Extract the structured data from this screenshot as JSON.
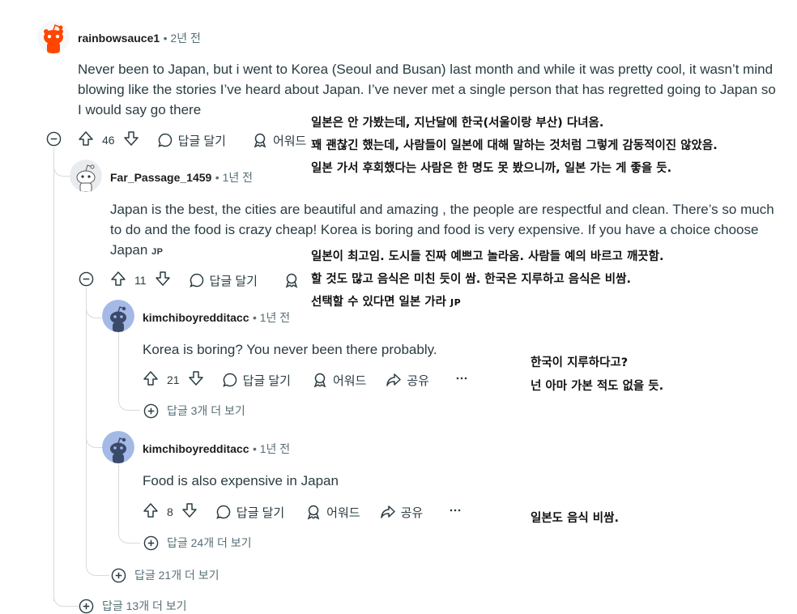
{
  "comments": [
    {
      "user": "rainbowsauce1",
      "time": "2년 전",
      "body": "Never been to Japan, but i went to Korea (Seoul and Busan) last month and while it was pretty cool, it wasn’t mind blowing like the stories I’ve heard about Japan. I’ve never met a single person that has regretted going to Japan so I would say go there",
      "votes": "46",
      "reply": "답글 달기",
      "award": "어워드"
    },
    {
      "user": "Far_Passage_1459",
      "time": "1년 전",
      "body": "Japan is the best, the cities are beautiful and amazing , the people are respectful and clean. There’s so much to do and the food is crazy cheap! Korea is boring and food is very expensive. If you have a choice choose Japan",
      "flag": "JP",
      "votes": "11",
      "reply": "답글 달기",
      "award": "어워드"
    },
    {
      "user": "kimchiboyredditacc",
      "time": "1년 전",
      "body": "Korea is boring? You never been there probably.",
      "votes": "21",
      "reply": "답글 달기",
      "award": "어워드",
      "share": "공유",
      "more_replies": "답글 3개 더 보기"
    },
    {
      "user": "kimchiboyredditacc",
      "time": "1년 전",
      "body": "Food is also expensive in Japan",
      "votes": "8",
      "reply": "답글 달기",
      "award": "어워드",
      "share": "공유",
      "more_replies": "답글 24개 더 보기"
    }
  ],
  "more_replies_level1": "답글 21개 더 보기",
  "more_replies_level0": "답글 13개 더 보기",
  "annotations": {
    "a1": [
      "일본은 안 가봤는데, 지난달에 한국(서울이랑 부산) 다녀옴.",
      "꽤 괜찮긴 했는데, 사람들이 일본에 대해 말하는 것처럼 그렇게 감동적이진 않았음.",
      "일본 가서 후회했다는 사람은 한 명도 못 봤으니까, 일본 가는 게 좋을 듯."
    ],
    "a2": [
      "일본이 최고임. 도시들 진짜 예쁘고 놀라움. 사람들 예의 바르고 깨끗함.",
      "할 것도 많고 음식은 미친 듯이 쌈. 한국은 지루하고 음식은 비쌈.",
      "선택할 수 있다면 일본 가라"
    ],
    "a2_flag": "JP",
    "a3": [
      "한국이 지루하다고?",
      "넌 아마 가본 적도 없을 듯."
    ],
    "a4": [
      "일본도 음식 비쌈."
    ]
  }
}
